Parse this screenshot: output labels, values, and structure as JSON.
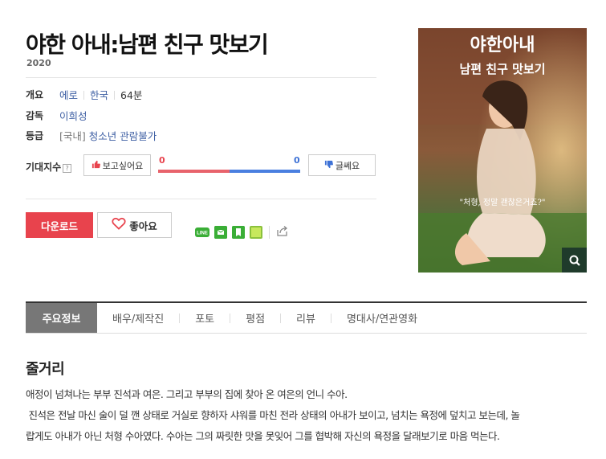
{
  "movie": {
    "title": "야한 아내:남편 친구 맛보기",
    "year": "2020"
  },
  "info": {
    "overview_label": "개요",
    "genre": "에로",
    "country": "한국",
    "runtime": "64분",
    "director_label": "감독",
    "director": "이희성",
    "rating_label": "등급",
    "rating_prefix": "[국내]",
    "rating": "청소년 관람불가"
  },
  "expectation": {
    "label": "기대지수",
    "help": "?",
    "want_label": "보고싶어요",
    "want_count": "0",
    "no_label": "글쎄요",
    "no_count": "0",
    "want_share": 0.5
  },
  "actions": {
    "download_label": "다운로드",
    "like_label": "좋아요"
  },
  "share": {
    "line_text": "LINE"
  },
  "poster": {
    "title_line1": "야한아내",
    "title_line2": "남편 친구 맛보기",
    "tagline": "\"처형, 정말 괜찮은거죠?\""
  },
  "tabs": [
    {
      "label": "주요정보"
    },
    {
      "label": "배우/제작진"
    },
    {
      "label": "포토"
    },
    {
      "label": "평점"
    },
    {
      "label": "리뷰"
    },
    {
      "label": "명대사/연관영화"
    }
  ],
  "synopsis": {
    "title": "줄거리",
    "line1": "애정이 넘쳐나는 부부 진석과 여은. 그리고 부부의 집에 찾아 온 여은의 언니 수아.",
    "line2": " 진석은 전날 마신 술이 덜 깬 상태로 거실로 향하자 샤워를 마친 전라 상태의 아내가 보이고, 넘치는 욕정에 덮치고 보는데, 놀",
    "line3": "랍게도 아내가 아닌 처형 수아였다. 수아는 그의 짜릿한 맛을 못잊어 그를 협박해 자신의 욕정을 달래보기로 마음 먹는다."
  }
}
